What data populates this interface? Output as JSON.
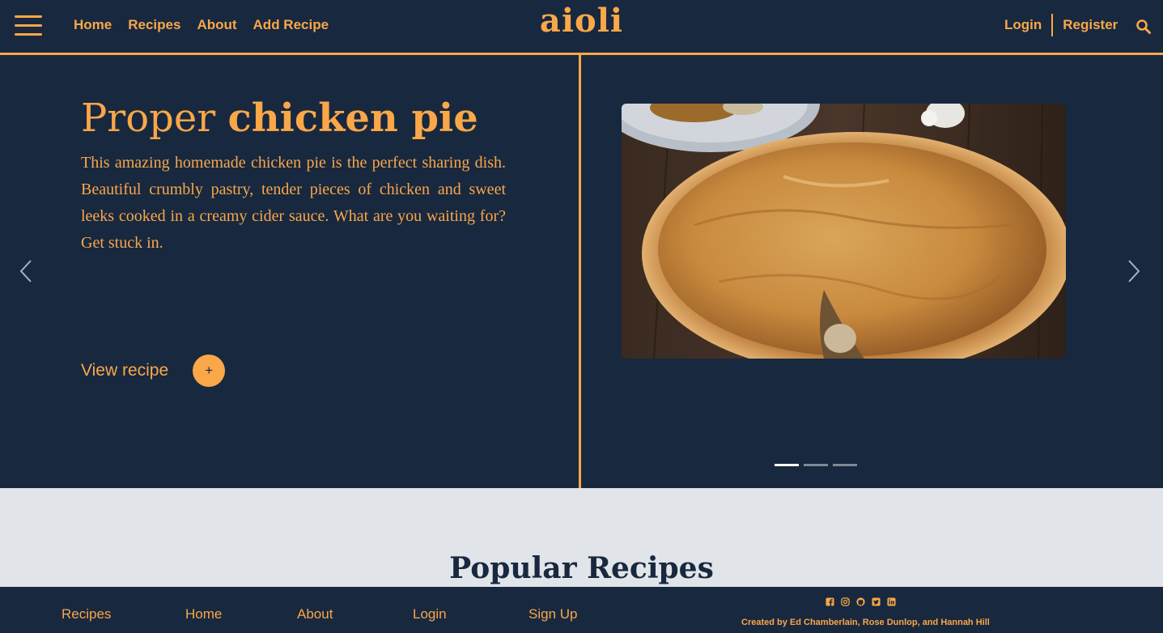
{
  "colors": {
    "navy": "#18283f",
    "orange": "#f9a748",
    "light_gray": "#e1e4e8"
  },
  "nav": {
    "menu_icon": "hamburger-menu-icon",
    "links": [
      "Home",
      "Recipes",
      "About",
      "Add Recipe"
    ],
    "brand": "aioli",
    "login": "Login",
    "register": "Register",
    "search_icon": "search-icon"
  },
  "hero": {
    "title_light": "Proper",
    "title_bold": "chicken pie",
    "description": "This amazing homemade chicken pie is the perfect sharing dish. Beautiful crumbly pastry, tender pieces of chicken and sweet leeks cooked in a creamy cider sauce. What are you waiting for? Get stuck in.",
    "cta_label": "View recipe",
    "cta_icon": "+",
    "slide_count": 3,
    "active_slide": 1
  },
  "popular": {
    "title": "Popular Recipes"
  },
  "footer": {
    "links": [
      "Recipes",
      "Home",
      "About",
      "Login",
      "Sign Up"
    ],
    "social_icons": [
      "facebook-icon",
      "instagram-icon",
      "github-icon",
      "twitter-icon",
      "linkedin-icon"
    ],
    "credits": "Created by Ed Chamberlain, Rose Dunlop, and Hannah Hill"
  }
}
